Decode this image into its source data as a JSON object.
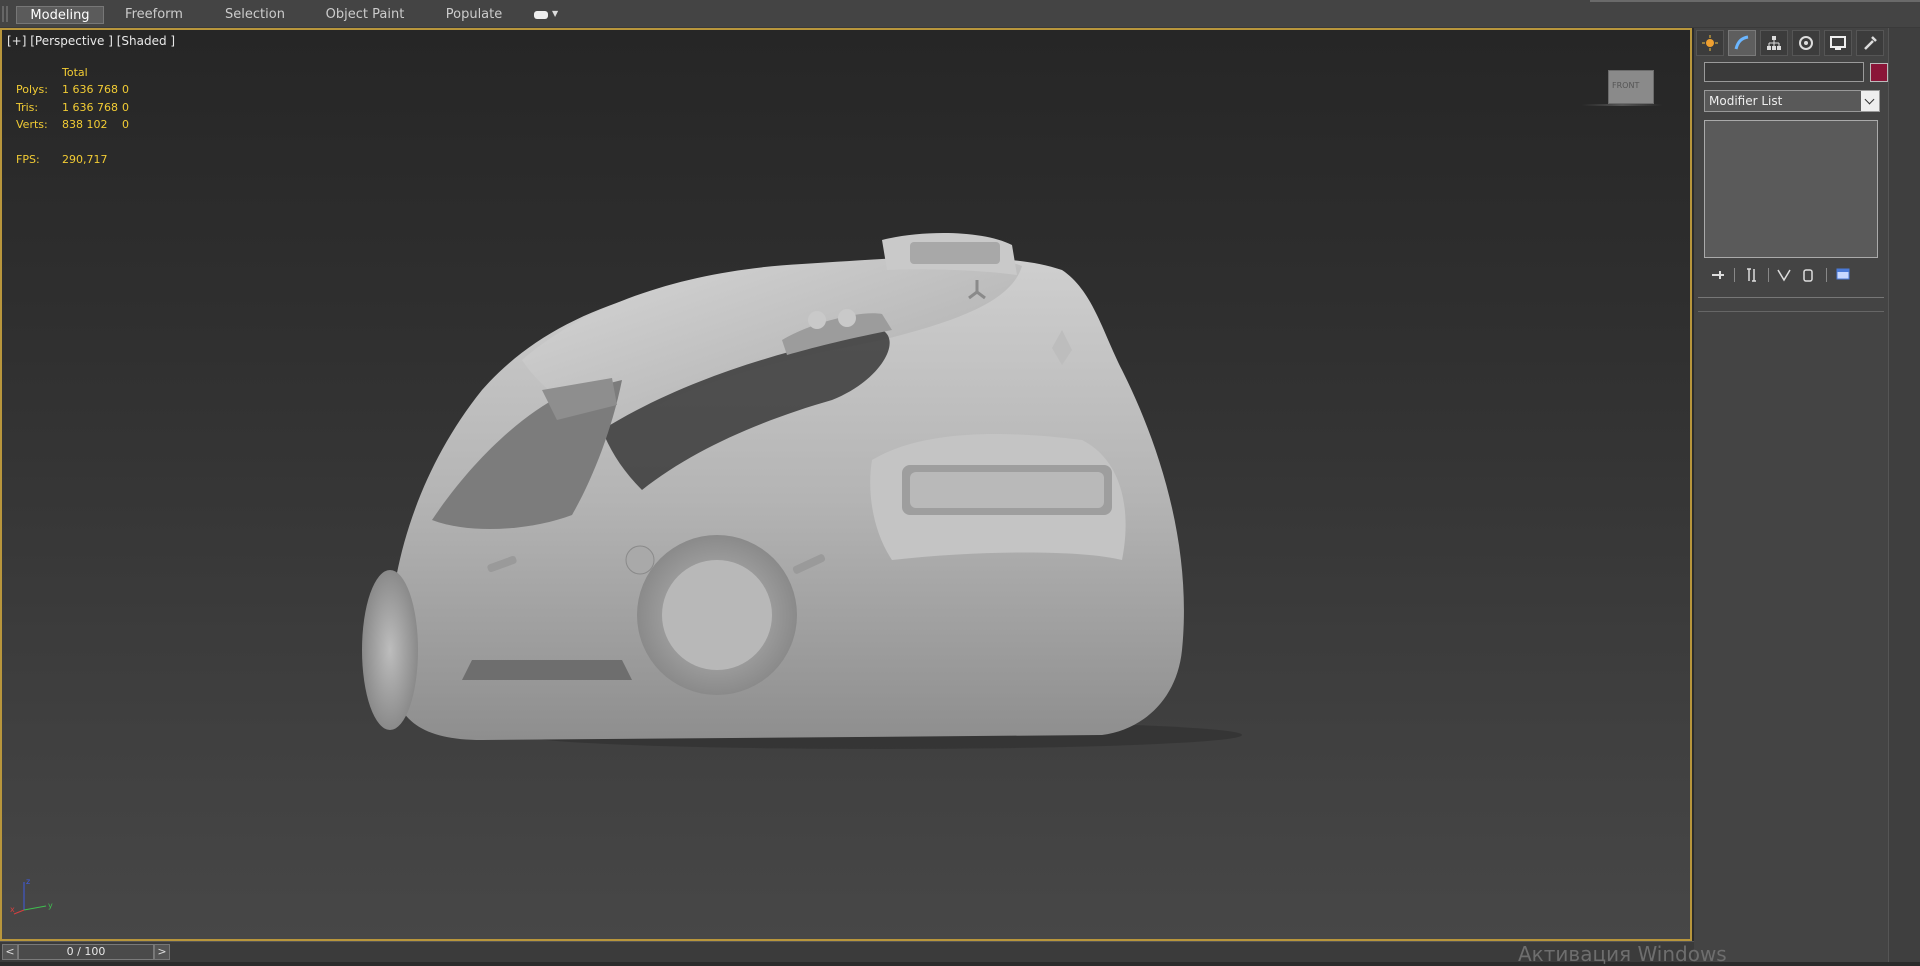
{
  "ribbon": {
    "tabs": [
      {
        "label": "Modeling",
        "active": true
      },
      {
        "label": "Freeform",
        "active": false
      },
      {
        "label": "Selection",
        "active": false
      },
      {
        "label": "Object Paint",
        "active": false
      },
      {
        "label": "Populate",
        "active": false
      }
    ],
    "extra_icon": "ribbon-options-icon"
  },
  "viewport": {
    "label": "[+] [Perspective ] [Shaded ]",
    "border_color": "#b8963c",
    "stats": {
      "header": "Total",
      "rows": [
        {
          "key": "Polys:",
          "total": "1 636 768",
          "selected": "0"
        },
        {
          "key": "Tris:",
          "total": "1 636 768",
          "selected": "0"
        },
        {
          "key": "Verts:",
          "total": "838 102",
          "selected": "0"
        }
      ],
      "fps_key": "FPS:",
      "fps_value": "290,717",
      "color": "#f2cc34"
    },
    "viewcube": {
      "face": "FRONT",
      "icon": "viewcube-icon"
    },
    "axis": {
      "x": "x",
      "y": "y",
      "z": "z"
    },
    "model": "3d-car-model-image"
  },
  "command_panel": {
    "tabs": [
      "create-icon",
      "modify-icon",
      "hierarchy-icon",
      "motion-icon",
      "display-icon",
      "utilities-icon"
    ],
    "active_tab": 1,
    "name_field": "",
    "object_color": "#8a1538",
    "modifier_list": "Modifier List",
    "stack_tools": [
      "pin-stack-icon",
      "show-end-result-icon",
      "make-unique-icon",
      "remove-modifier-icon",
      "configure-modifier-sets-icon"
    ]
  },
  "time_slider": {
    "value": "0 / 100",
    "prev": "<",
    "next": ">"
  },
  "watermark": "Активация Windows"
}
